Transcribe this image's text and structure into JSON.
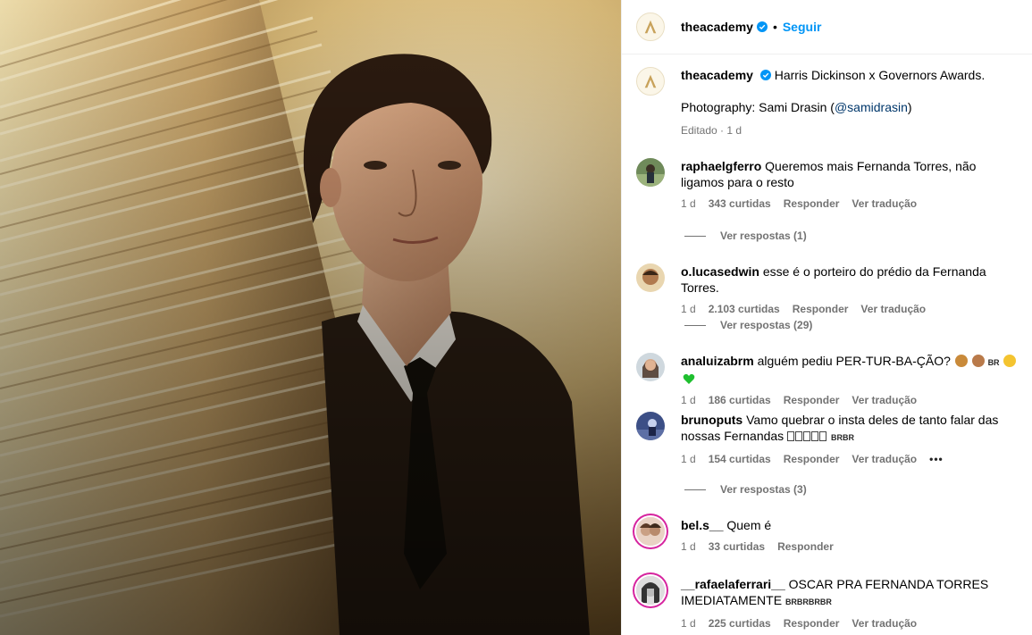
{
  "account": {
    "username": "theacademy",
    "follow_label": "Seguir",
    "dot": "•"
  },
  "caption": {
    "username": "theacademy",
    "text": "Harris Dickinson x Governors Awards.",
    "photo_prefix": "Photography: Sami Drasin (",
    "mention": "@samidrasin",
    "photo_suffix": ")",
    "meta": "Editado · 1 d"
  },
  "comments": [
    {
      "username": "raphaelgferro",
      "text": "Queremos mais Fernanda Torres, não ligamos para o resto",
      "time": "1 d",
      "likes": "343 curtidas",
      "reply": "Responder",
      "translate": "Ver tradução",
      "replies": "Ver respostas (1)"
    },
    {
      "username": "o.lucasedwin",
      "text": "esse é o porteiro do prédio da Fernanda Torres.",
      "time": "1 d",
      "likes": "2.103 curtidas",
      "reply": "Responder",
      "translate": "Ver tradução",
      "replies": "Ver respostas (29)"
    },
    {
      "username": "analuizabrm",
      "text": "alguém pediu PER-TUR-BA-ÇÃO?",
      "tag": "BR",
      "time": "1 d",
      "likes": "186 curtidas",
      "reply": "Responder",
      "translate": "Ver tradução"
    },
    {
      "username": "brunoputs",
      "text": "Vamo quebrar o insta deles de tanto falar das nossas Fernandas",
      "tag": "BRBR",
      "time": "1 d",
      "likes": "154 curtidas",
      "reply": "Responder",
      "translate": "Ver tradução",
      "more": "•••",
      "replies": "Ver respostas (3)"
    },
    {
      "username": "bel.s__",
      "text": "Quem é",
      "time": "1 d",
      "likes": "33 curtidas",
      "reply": "Responder"
    },
    {
      "username": "__rafaelaferrari__",
      "text": "OSCAR PRA FERNANDA TORRES IMEDIATAMENTE",
      "tag": "BRBRBRBR",
      "time": "1 d",
      "likes": "225 curtidas",
      "reply": "Responder",
      "translate": "Ver tradução"
    }
  ],
  "colors": {
    "link": "#0095f6",
    "verified": "#0095f6",
    "muted": "#737373",
    "mention": "#00376b",
    "story_ring": "#d6249f"
  }
}
